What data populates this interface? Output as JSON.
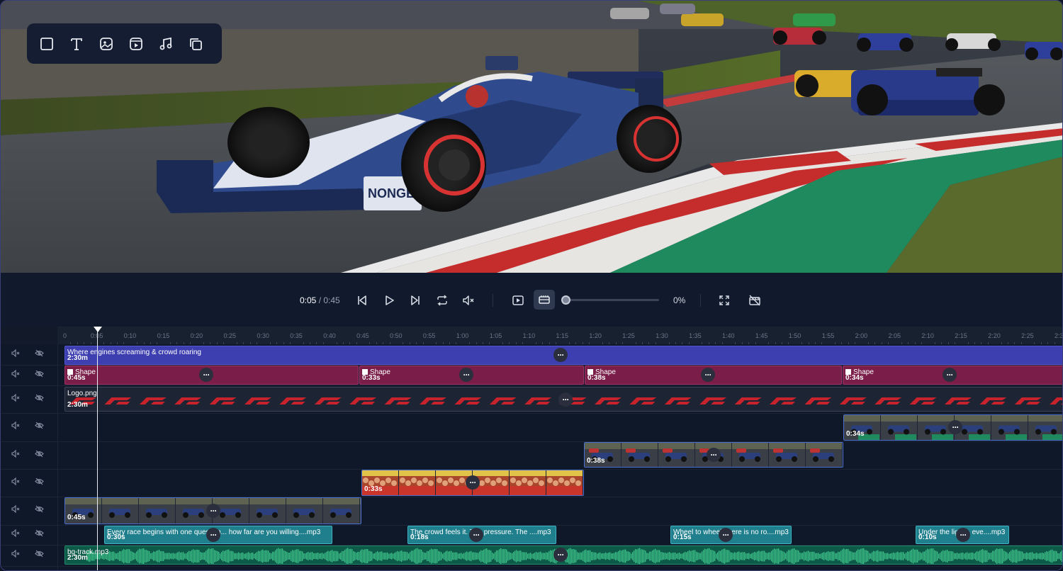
{
  "toolbar": {
    "tools": [
      {
        "icon": "square-shape-icon"
      },
      {
        "icon": "text-icon"
      },
      {
        "icon": "image-icon"
      },
      {
        "icon": "video-icon"
      },
      {
        "icon": "music-icon"
      },
      {
        "icon": "layers-icon"
      }
    ]
  },
  "player": {
    "current_time": "0:05",
    "separator": " / ",
    "total_time": "0:45",
    "zoom_percent": "0%",
    "zoom_value": 0
  },
  "ruler": {
    "labels": [
      "0",
      "0:05",
      "0:10",
      "0:15",
      "0:20",
      "0:25",
      "0:30",
      "0:35",
      "0:40",
      "0:45",
      "0:50",
      "0:55",
      "1:00",
      "1:05",
      "1:10",
      "1:15",
      "1:20",
      "1:25",
      "1:30",
      "1:35",
      "1:40",
      "1:45",
      "1:50",
      "1:55",
      "2:00",
      "2:05",
      "2:10",
      "2:15",
      "2:20",
      "2:25",
      "2:3"
    ]
  },
  "tracks": {
    "text": {
      "title": "Where engines screaming & crowd roaring",
      "duration": "2:30m"
    },
    "shapes": [
      {
        "label": "Shape",
        "duration": "0:45s"
      },
      {
        "label": "Shape",
        "duration": "0:33s"
      },
      {
        "label": "Shape",
        "duration": "0:38s"
      },
      {
        "label": "Shape",
        "duration": "0:34s"
      }
    ],
    "logo": {
      "name": "Logo.png",
      "duration": "2:30m"
    },
    "videos": [
      {
        "duration": "0:34s"
      },
      {
        "duration": "0:38s"
      },
      {
        "duration": "0:33s"
      },
      {
        "duration": "0:45s"
      }
    ],
    "voiceovers": [
      {
        "name": "Every race begins with one question... how far are you willing....mp3",
        "duration": "0:30s"
      },
      {
        "name": "The crowd feels it. The pressure. The ....mp3",
        "duration": "0:18s"
      },
      {
        "name": "Wheel to wheel, there is no ro....mp3",
        "duration": "0:15s"
      },
      {
        "name": "Under the lights, eve....mp3",
        "duration": "0:10s"
      }
    ],
    "audio": {
      "name": "bg-track.mp3",
      "duration": "2:30m"
    }
  },
  "colors": {
    "text_track": "#3d3fb0",
    "shape_track": "#7a1d49",
    "voiceover_track": "#1f7f8d",
    "audio_track": "#0e5a48",
    "video_border": "#4a6fd0"
  }
}
